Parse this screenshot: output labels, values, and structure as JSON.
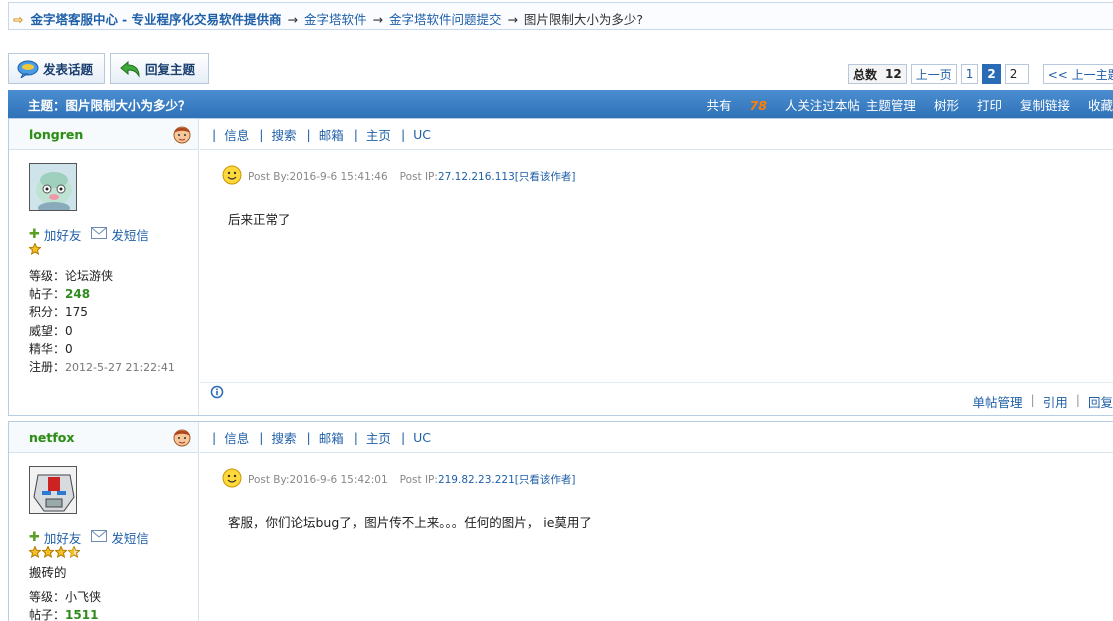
{
  "breadcrumb": {
    "home": "金字塔客服中心",
    "tagline": " - 专业程序化交易软件提供商",
    "crumbs": [
      "金字塔软件",
      "金字塔软件问题提交"
    ],
    "current": "图片限制大小为多少?"
  },
  "toolbar": {
    "new_topic": "发表话题",
    "reply_topic": "回复主题"
  },
  "pager": {
    "total_label": "总数",
    "total": "12",
    "prev": "上一页",
    "pages": [
      "1",
      "2"
    ],
    "current_page": "2",
    "jump_value": "2",
    "prev_topic": "<< 上一主题"
  },
  "topic": {
    "title": "主题：图片限制大小为多少？",
    "follow_prefix": "共有",
    "follow_count": "78",
    "follow_suffix": "人关注过本帖",
    "tools": [
      "主题管理",
      "树形",
      "打印",
      "复制链接",
      "收藏"
    ]
  },
  "nav": [
    "信息",
    "搜索",
    "邮箱",
    "主页",
    "UC"
  ],
  "labels": {
    "add_friend": "加好友",
    "message": "发短信",
    "post_by": "Post By:",
    "post_ip": "Post IP:",
    "author_only": "[只看该作者]"
  },
  "posts": [
    {
      "user": "longren",
      "level": "等级：论坛游侠",
      "posts_label": "帖子：",
      "posts": "248",
      "points": "积分：175",
      "prestige": "威望：0",
      "elite": "精华：0",
      "reg_label": "注册：",
      "reg": "2012-5-27 21:22:41",
      "time": "2016-9-6 15:41:46",
      "ip": "27.12.216.113",
      "content": "后来正常了",
      "foot_actions": [
        "单帖管理",
        "引用",
        "回复"
      ]
    },
    {
      "user": "netfox",
      "title": "搬砖的",
      "level": "等级：小飞侠",
      "posts_label": "帖子：",
      "posts": "1511",
      "time": "2016-9-6 15:42:01",
      "ip": "219.82.23.221",
      "content": "客服，你们论坛bug了，图片传不上来。。。任何的图片，  ie莫用了"
    }
  ],
  "colors": {
    "header_blue": "#2f72b8",
    "link": "#1f5fa8",
    "accent_orange": "#ff7e00",
    "username_green": "#2e8b1e"
  }
}
